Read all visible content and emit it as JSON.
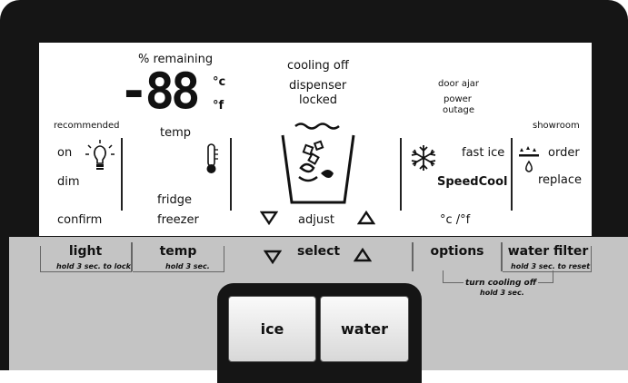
{
  "display": {
    "percent_remaining": "% remaining",
    "temp_digits": "-88",
    "unit_c": "°c",
    "unit_f": "°f",
    "temp_label": "temp",
    "cooling_off": "cooling off",
    "dispenser": "dispenser",
    "locked": "locked",
    "door_ajar": "door ajar",
    "power": "power",
    "outage": "outage",
    "recommended": "recommended",
    "on": "on",
    "dim": "dim",
    "confirm": "confirm",
    "fridge": "fridge",
    "freezer": "freezer",
    "adjust": "adjust",
    "fast_ice": "fast ice",
    "speedcool": "SpeedCool",
    "units_toggle": "°c /°f",
    "showroom": "showroom",
    "order": "order",
    "replace": "replace"
  },
  "buttons": {
    "light": "light",
    "light_sub": "hold 3 sec. to lock",
    "temp": "temp",
    "temp_sub": "hold 3 sec.",
    "select": "select",
    "options": "options",
    "water_filter": "water filter",
    "water_filter_sub": "hold 3 sec. to reset",
    "turn_cooling_off": "turn cooling off",
    "turn_cooling_off_sub": "hold 3 sec."
  },
  "dispenser": {
    "ice": "ice",
    "water": "water"
  },
  "icons": [
    "light-bulb-icon",
    "thermometer-icon",
    "ice-glass-icon",
    "snowflake-icon",
    "water-filter-icon",
    "arrow-down-icon",
    "arrow-up-icon"
  ]
}
